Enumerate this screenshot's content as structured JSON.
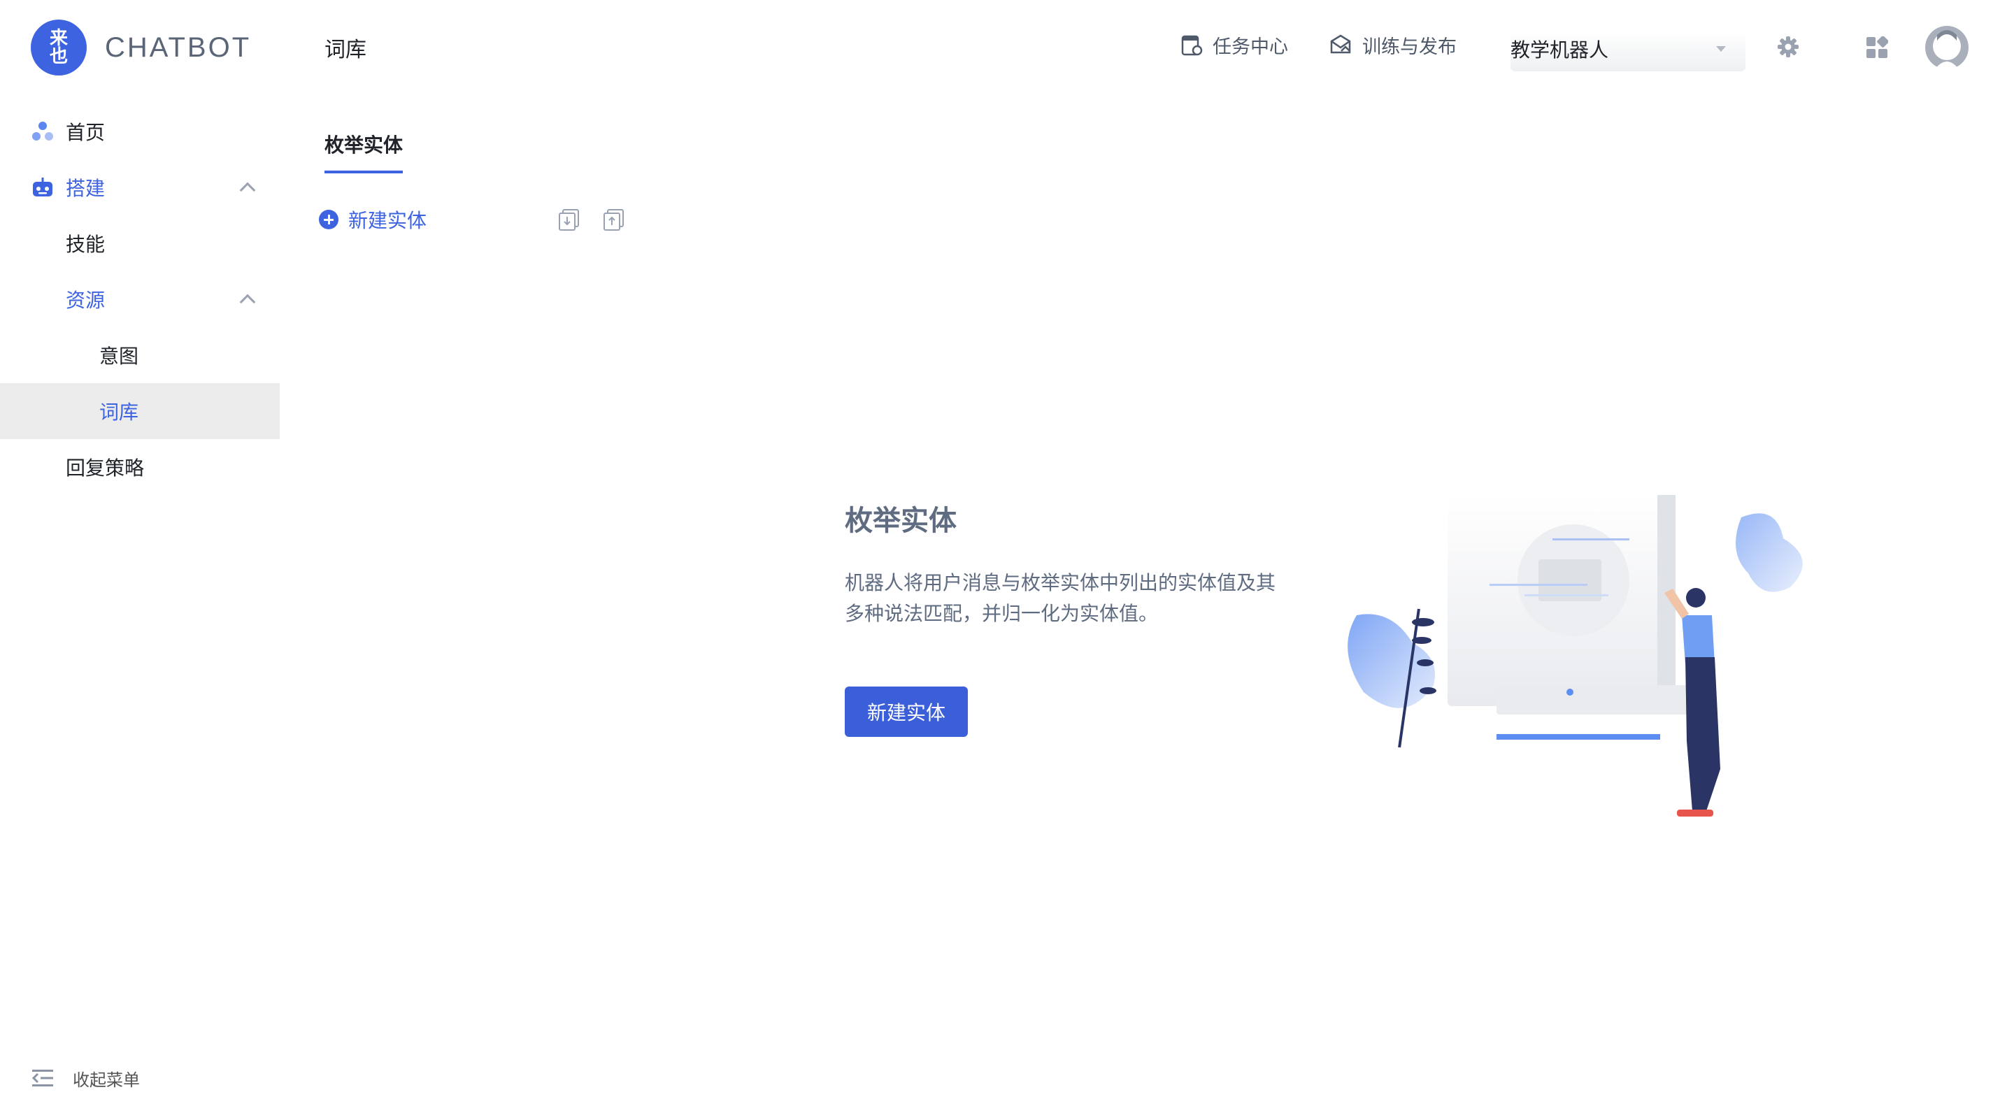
{
  "brand": {
    "badge_line1": "来",
    "badge_line2": "也",
    "name": "CHATBOT",
    "accent_color": "#3d63e0"
  },
  "sidebar": {
    "items": [
      {
        "label": "首页",
        "icon": "home-icon"
      },
      {
        "label": "搭建",
        "icon": "robot-icon"
      },
      {
        "label": "技能"
      },
      {
        "label": "资源"
      },
      {
        "label": "意图"
      },
      {
        "label": "词库"
      },
      {
        "label": "回复策略"
      }
    ],
    "collapse_label": "收起菜单"
  },
  "header": {
    "page_title": "词库",
    "task_center": "任务中心",
    "train_publish": "训练与发布",
    "bot_select_value": "教学机器人",
    "settings_icon": "gear-icon",
    "apps_icon": "grid-icon",
    "avatar_icon": "avatar"
  },
  "tabs": [
    {
      "label": "枚举实体",
      "active": true
    }
  ],
  "toolbar": {
    "new_entity": "新建实体",
    "import_icon": "import-icon",
    "export_icon": "export-icon"
  },
  "empty_state": {
    "title": "枚举实体",
    "description": "机器人将用户消息与枚举实体中列出的实体值及其多种说法匹配，并归一化为实体值。",
    "button_label": "新建实体"
  }
}
